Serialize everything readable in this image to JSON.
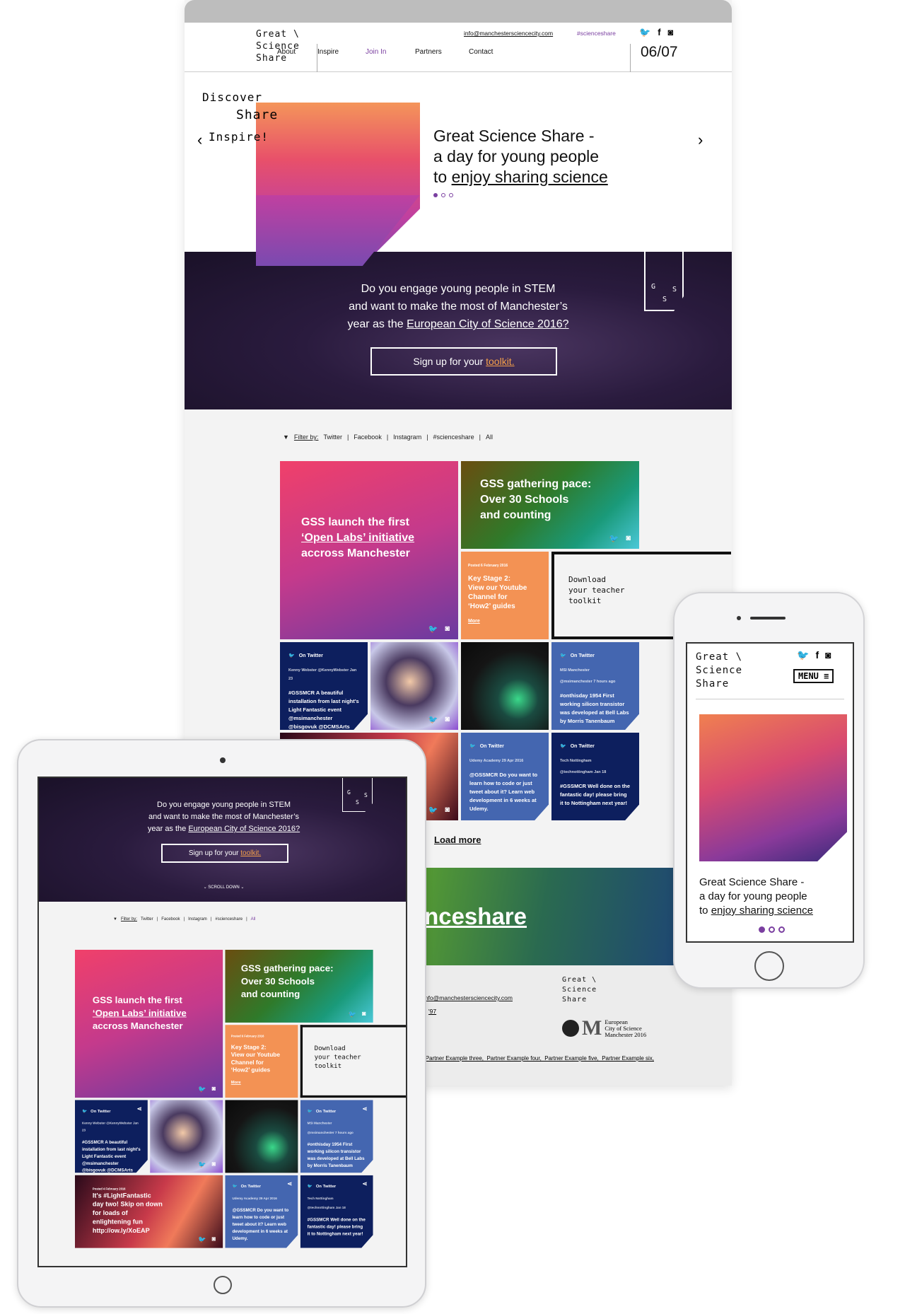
{
  "logo": {
    "line1": "Great \\",
    "line2": "Science",
    "line3": "Share"
  },
  "header": {
    "email": "info@manchestersciencecity.com",
    "hashtag": "#scienceshare",
    "page_counter": "06/07",
    "nav": [
      {
        "label": "About"
      },
      {
        "label": "Inspire"
      },
      {
        "label": "Join In",
        "active": true
      },
      {
        "label": "Partners"
      },
      {
        "label": "Contact"
      }
    ],
    "social": [
      "twitter-icon",
      "facebook-icon",
      "instagram-icon"
    ]
  },
  "hero": {
    "tag1": "Discover",
    "tag2": "Share",
    "tag3": "Inspire!",
    "title_line1": "Great Science Share -",
    "title_line2": "a day for young people",
    "title_line3_prefix": "to ",
    "title_line3_link": "enjoy sharing science",
    "slides": 3,
    "active_slide": 1
  },
  "banner": {
    "line1": "Do you engage young people in STEM",
    "line2": "and want to make the most of Manchester’s",
    "line3_prefix": "year as the ",
    "line3_link": "European City of Science 2016?",
    "cta_prefix": "Sign up for your ",
    "cta_link": "toolkit.",
    "badge": "GSS",
    "scroll": "SCROLL DOWN"
  },
  "filter": {
    "label": "Filter by:",
    "options": [
      "Twitter",
      "Facebook",
      "Instagram",
      "#scienceshare",
      "All"
    ]
  },
  "tiles": [
    {
      "type": "photo",
      "title": [
        "GSS launch the first",
        "‘Open Labs’ initiative",
        "accross Manchester"
      ],
      "bg": "linear-gradient(160deg,#f0406a 0%,#c43a8c 50%,#6a3aa0 100%)"
    },
    {
      "type": "photo",
      "title": [
        "GSS gathering pace:",
        "Over 30 Schools",
        "and counting"
      ],
      "bg": "linear-gradient(135deg,#6a4d10 0%,#2f7a2a 45%,#1a9a7a 75%,#4ac8d8 100%)"
    },
    {
      "type": "post",
      "meta": "Posted 6 February 2016",
      "title": [
        "Key Stage 2:",
        "View our Youtube",
        "Channel for",
        "‘How2’ guides"
      ],
      "link": "More",
      "bg": "#f39254"
    },
    {
      "type": "download",
      "title": [
        "Download",
        "your teacher",
        "toolkit"
      ]
    },
    {
      "type": "tweet",
      "label": "On Twitter",
      "meta": [
        "Kenny Webster @KennyWebster Jan 23"
      ],
      "body": "#GSSMCR A beautiful installation from last night's Light Fantastic event @msimanchester @bisgovuk @DCMSArts #plasticcups",
      "bg": "#0d1f5e"
    },
    {
      "type": "photo",
      "title": [],
      "bg": "radial-gradient(circle at 45% 45%,#f2c9a8 0%,#4a3a60 35%,#c8c8e8 70%,#8a4ad0 100%)"
    },
    {
      "type": "photo",
      "title": [],
      "bg": "radial-gradient(circle at 65% 65%,#3ad88a 0%,#1a4a40 25%,#151515 60%,#0a0a0a 100%)"
    },
    {
      "type": "tweet",
      "label": "On Twitter",
      "meta": [
        "MSI Manchester",
        "@msimanchester 7 hours ago"
      ],
      "body": "#onthisday 1954 First working silicon transistor was developed at Bell Labs by Morris Tanenbaum",
      "bg": "#4466b0"
    },
    {
      "type": "photo",
      "meta": "Posted 4 February 2016",
      "title": [
        "It's #LightFantastic",
        "day two! Skip on down",
        "for loads of",
        "enlightening fun",
        "http://ow.ly/XoEAP"
      ],
      "bg": "linear-gradient(120deg,#2a0a1a 0%,#c83a4a 50%,#f07a5a 70%,#3a0a1a 100%)"
    },
    {
      "type": "tweet",
      "label": "On Twitter",
      "meta": [
        "Udemy Academy 29 Apr 2016"
      ],
      "body": "@GSSMCR Do you want to learn how to code or just tweet about it? Learn web development in 6 weeks at Udemy.",
      "bg": "#4466b0"
    },
    {
      "type": "tweet",
      "label": "On Twitter",
      "meta": [
        "Tech Nottingham",
        "@technottingham Jan 18"
      ],
      "body": "#GSSMCR Well done on the fantastic day! please bring it to Nottingham next year!",
      "bg": "#0d1f5e"
    }
  ],
  "load_more": "Load more",
  "promo": {
    "hashtag": "#scienceshare"
  },
  "footer": {
    "email": "info@manchestersciencecity.com",
    "phone_fragment": "'97",
    "partners": "Partner Example three,  Partner Example four,  Partner Example five,  Partner Example six,",
    "ecos_line1": "European",
    "ecos_line2": "City of Science",
    "ecos_line3": "Manchester 2016",
    "ecos_mark": "M"
  },
  "phone": {
    "menu": "MENU",
    "title_line1": "Great Science Share -",
    "title_line2": "a day for young people",
    "title_line3_prefix": "to ",
    "title_line3_link": "enjoy sharing science"
  },
  "colors": {
    "accent": "#7a3fa0",
    "orange": "#f39254",
    "navy": "#0d1f5e",
    "blue": "#4466b0",
    "toolkit": "#f5a04a"
  }
}
